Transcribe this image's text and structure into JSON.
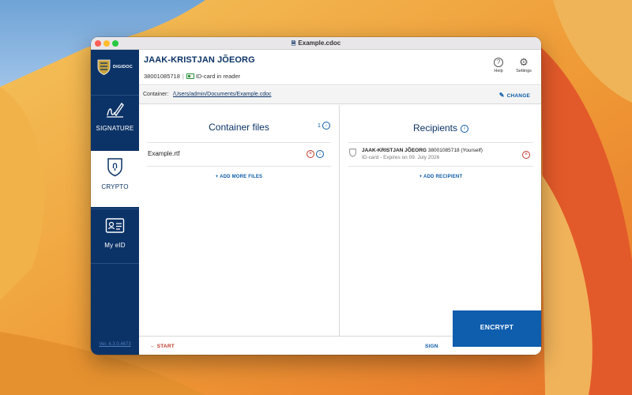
{
  "window": {
    "title": "Example.cdoc"
  },
  "sidebar": {
    "brand": "DIGIDOC",
    "items": [
      {
        "label": "SIGNATURE",
        "icon": "signature-icon",
        "active": false
      },
      {
        "label": "CRYPTO",
        "icon": "crypto-icon",
        "active": true
      },
      {
        "label": "My eID",
        "icon": "id-card-icon",
        "active": false
      }
    ],
    "version": "Ver. 4.3.0.4673"
  },
  "header": {
    "name": "JAAK-KRISTJAN JÕEORG",
    "personal_code": "38001085718",
    "card_status": "ID-card in reader",
    "help_label": "Help",
    "settings_label": "Settings"
  },
  "container": {
    "label": "Container:",
    "path": "/Users/admin/Documents/Example.cdoc",
    "change_label": "CHANGE"
  },
  "files_panel": {
    "title": "Container files",
    "count": "1",
    "files": [
      {
        "name": "Example.rtf"
      }
    ],
    "add_label": "+ ADD MORE FILES"
  },
  "recipients_panel": {
    "title": "Recipients",
    "recipients": [
      {
        "name": "JAAK-KRISTJAN JÕEORG",
        "details": "38001085718 (Yourself)",
        "expiry": "ID-card - Expires on 09. July 2026"
      }
    ],
    "add_label": "+ ADD RECIPIENT"
  },
  "footer": {
    "start_label": "← START",
    "sign_label": "SIGN",
    "encrypt_label": "ENCRYPT"
  },
  "colors": {
    "sidebar": "#0c3367",
    "accent": "#0f5eae",
    "danger": "#c0392b"
  }
}
